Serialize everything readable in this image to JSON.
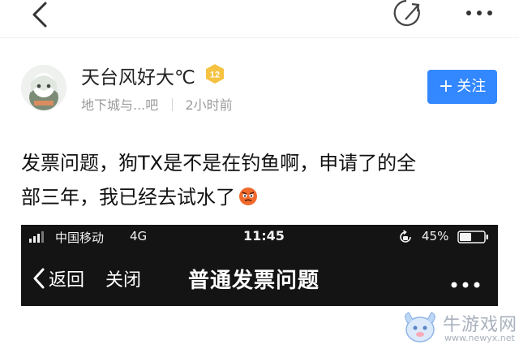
{
  "topbar": {
    "back_icon": "chevron-left-icon",
    "share_icon": "share-icon",
    "more_icon": "more-dots-icon"
  },
  "author": {
    "name": "天台风好大℃",
    "level": "12",
    "forum": "地下城与...吧",
    "time": "2小时前",
    "follow_label": "关注"
  },
  "post": {
    "line1": "发票问题，狗TX是不是在钓鱼啊，申请了的全",
    "line2": "部三年，我已经去试水了"
  },
  "screenshot": {
    "carrier": "中国移动",
    "network": "4G",
    "time": "11:45",
    "battery": "45%",
    "back_label": "返回",
    "close_label": "关闭",
    "title": "普通发票问题"
  },
  "watermark": {
    "name": "牛游戏网",
    "url": "www.newyx.net"
  },
  "colors": {
    "accent": "#3388ff",
    "badge": "#f5c242",
    "embed_bg": "#141414"
  }
}
